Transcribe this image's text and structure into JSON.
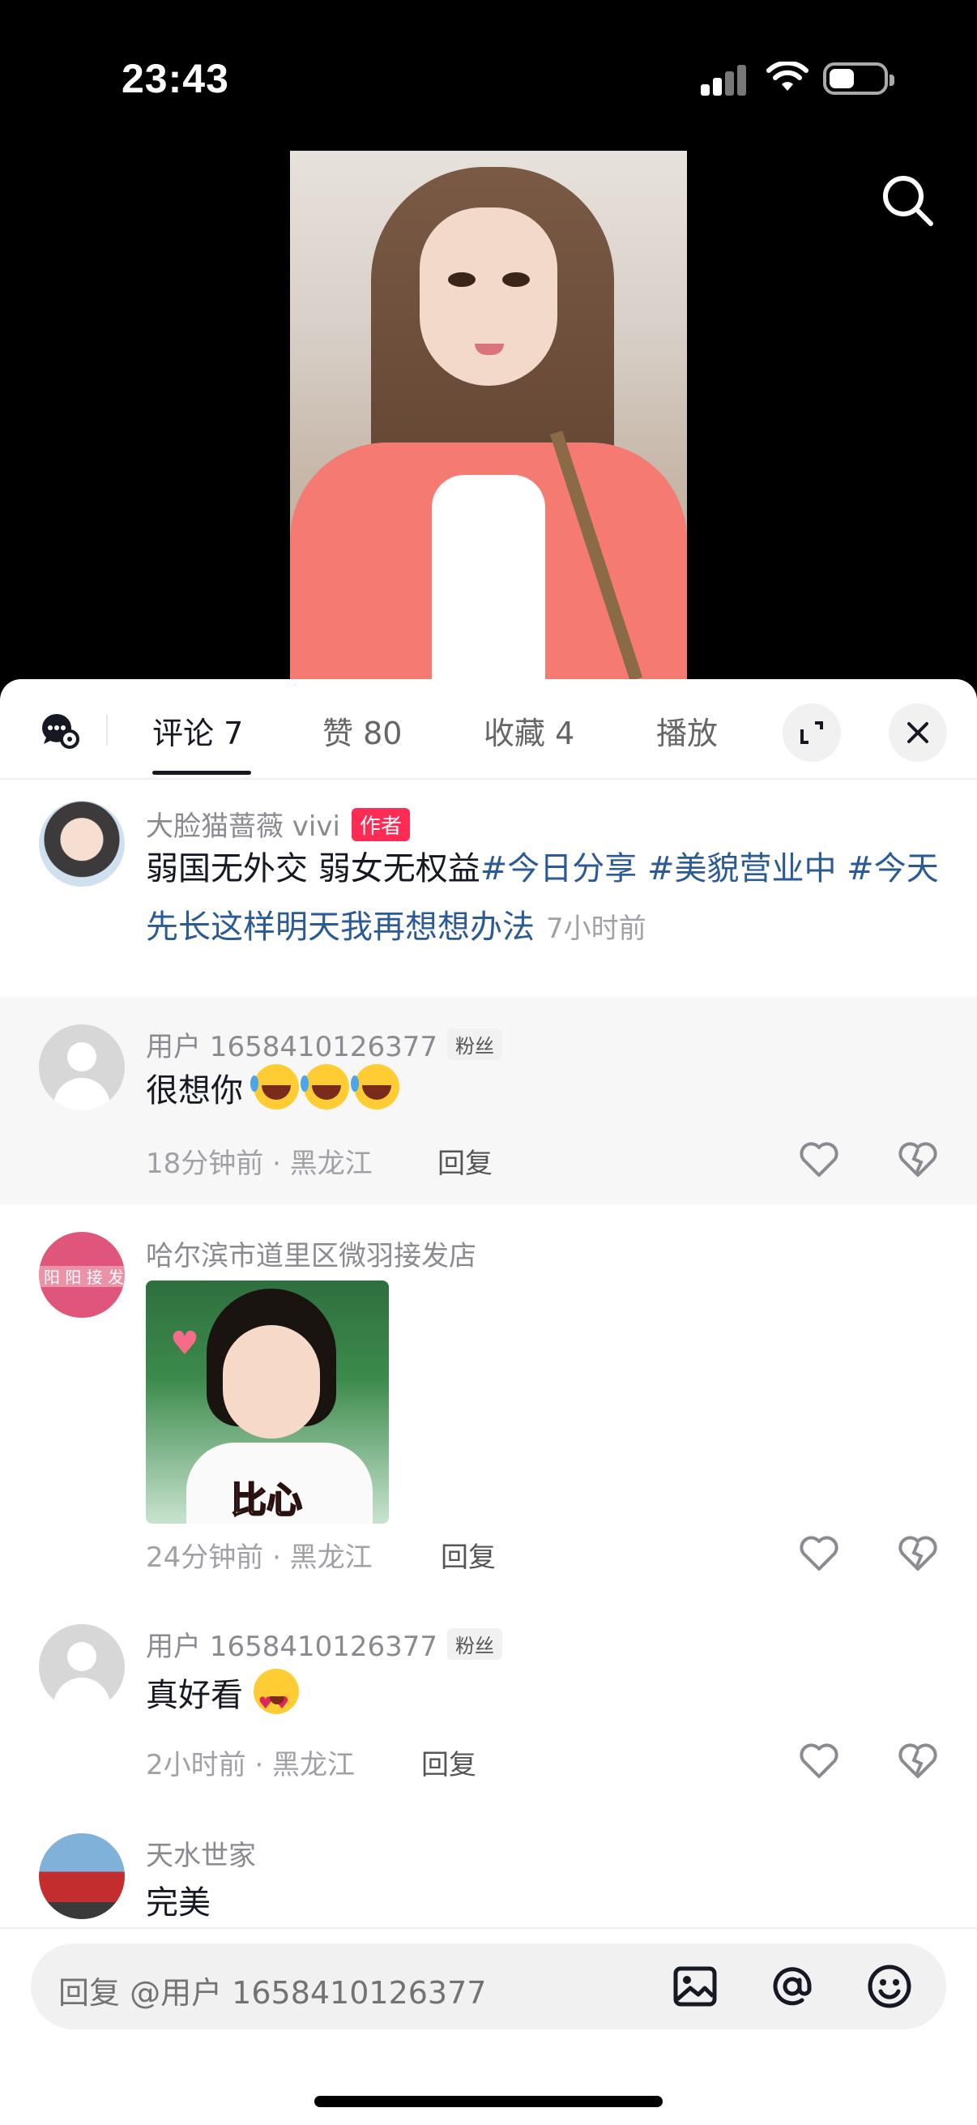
{
  "status_bar": {
    "time": "23:43"
  },
  "tabs": {
    "comments": "评论 7",
    "likes": "赞 80",
    "favorites": "收藏 4",
    "plays": "播放"
  },
  "caption": {
    "author": "大脸猫蔷薇 vivi",
    "author_badge": "作者",
    "text_plain": "弱国无外交  弱女无权益",
    "text_tags": "#今日分享 #美貌营业中 #今天先长这样明天我再想想办法",
    "time": "7小时前"
  },
  "comments": [
    {
      "user": "用户 1658410126377",
      "badge": "粉丝",
      "text": "很想你",
      "meta": "18分钟前 · 黑龙江",
      "reply": "回复",
      "emojis": [
        "laugh-cry",
        "laugh-cry",
        "laugh-cry"
      ]
    },
    {
      "user": "哈尔滨市道里区微羽接发店",
      "sticker_caption": "比心",
      "avatar_sign_text": "阳 阳 接 发",
      "meta": "24分钟前 · 黑龙江",
      "reply": "回复"
    },
    {
      "user": "用户 1658410126377",
      "badge": "粉丝",
      "text": "真好看",
      "meta": "2小时前 · 黑龙江",
      "reply": "回复",
      "emojis": [
        "heart-eyes"
      ]
    },
    {
      "user": "天水世家",
      "text": "完美"
    }
  ],
  "input": {
    "placeholder": "回复 @用户 1658410126377"
  },
  "colors": {
    "accent": "#fe2c55",
    "hashtag": "#2b5a95",
    "meta_gray": "#a0a1a6"
  }
}
